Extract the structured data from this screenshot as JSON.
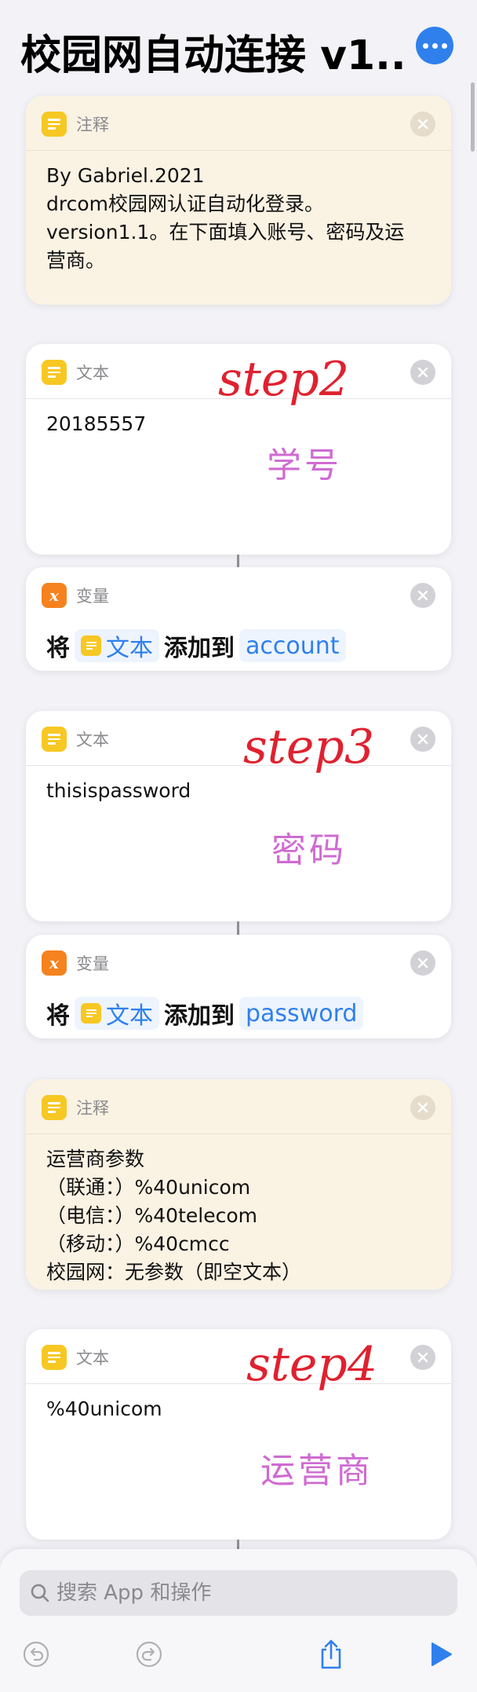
{
  "header": {
    "title": "校园网自动连接 v1...",
    "more_icon": "ellipsis-circle-icon",
    "accent": "#2f80ed"
  },
  "cards": {
    "comment1": {
      "label": "注释",
      "icon": "text-lines-icon",
      "body": "By Gabriel.2021\ndrcom校园网认证自动化登录。\nversion1.1。在下面填入账号、密码及运\n营商。"
    },
    "text1": {
      "label": "文本",
      "icon": "text-lines-icon",
      "body": "20185557"
    },
    "var1": {
      "label": "变量",
      "icon": "variable-x-icon",
      "prefix": "将",
      "input_label": "文本",
      "middle": "添加到",
      "target": "account"
    },
    "text2": {
      "label": "文本",
      "icon": "text-lines-icon",
      "body": "thisispassword"
    },
    "var2": {
      "label": "变量",
      "icon": "variable-x-icon",
      "prefix": "将",
      "input_label": "文本",
      "middle": "添加到",
      "target": "password"
    },
    "comment2": {
      "label": "注释",
      "icon": "text-lines-icon",
      "body": "运营商参数\n（联通：）%40unicom\n（电信：）%40telecom\n（移动：）%40cmcc\n校园网：无参数（即空文本）"
    },
    "text3": {
      "label": "文本",
      "icon": "text-lines-icon",
      "body": "%40unicom"
    }
  },
  "annotations": {
    "step2": "step2",
    "label_student_id": "学号",
    "step3": "step3",
    "label_password": "密码",
    "step4": "step4",
    "label_carrier": "运营商"
  },
  "bottom": {
    "search_placeholder": "搜索 App 和操作",
    "icons": [
      "undo-icon",
      "redo-icon",
      "share-icon",
      "play-icon"
    ]
  },
  "colors": {
    "comment_bg": "#faf2e3",
    "text_icon": "#f7c823",
    "variable_icon": "#f5821f",
    "handwriting_red": "#e0212f",
    "handwriting_purple": "#cf6bd2"
  }
}
